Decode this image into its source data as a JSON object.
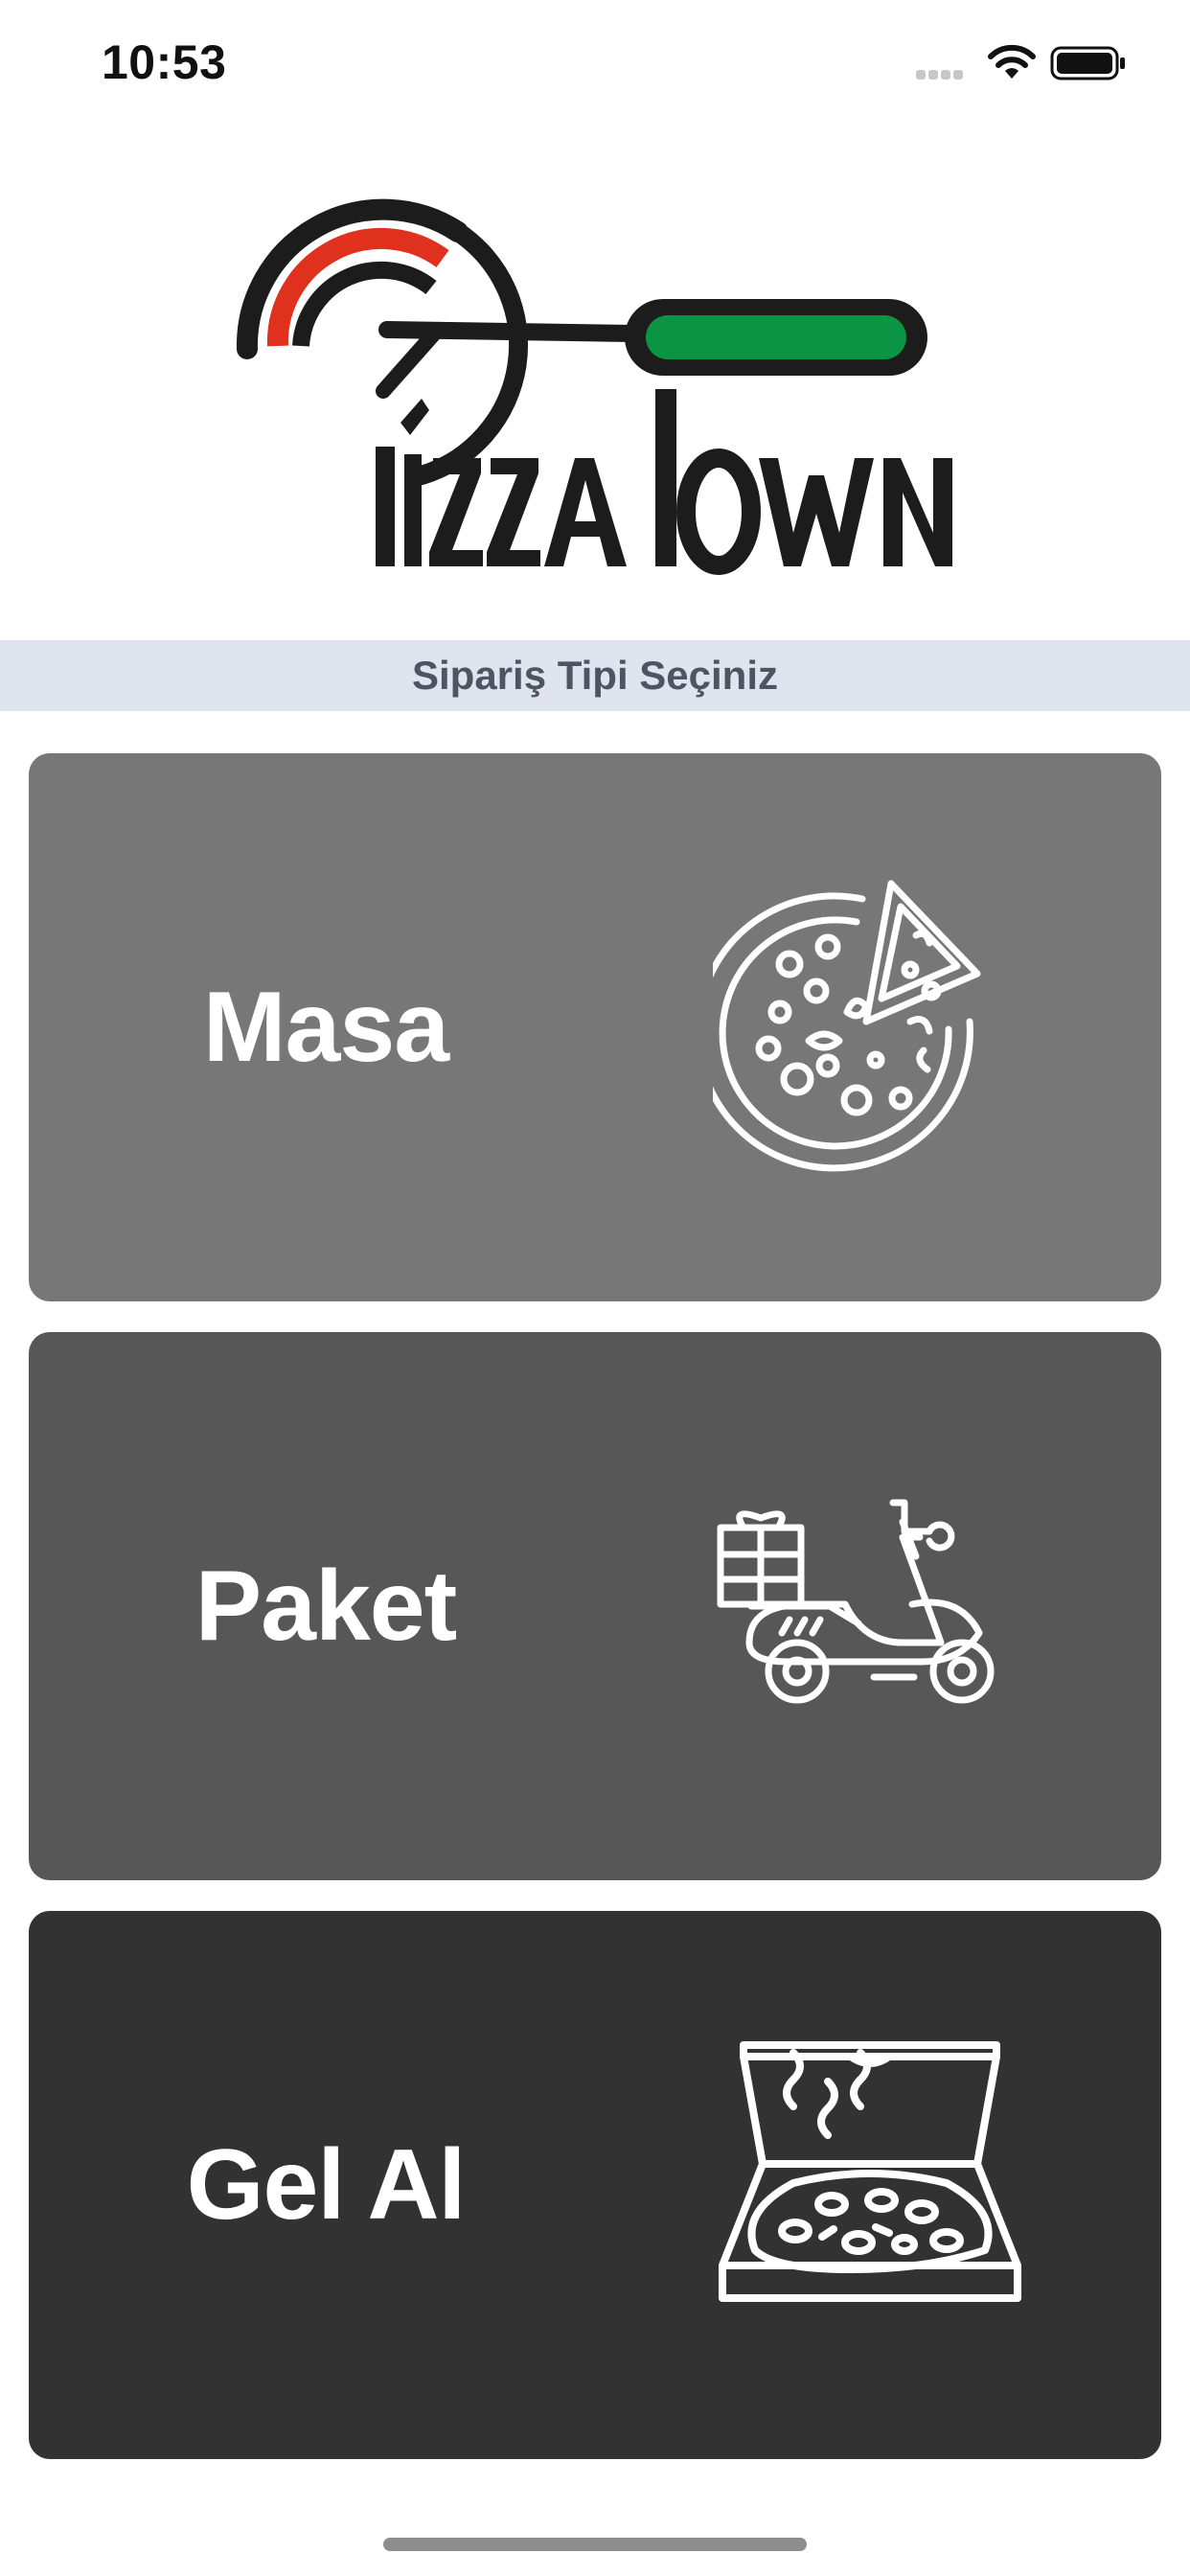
{
  "status_bar": {
    "time": "10:53",
    "wifi_icon": "wifi-icon",
    "battery_icon": "battery-icon"
  },
  "logo": {
    "text": "PizzaTown",
    "accent_red": "#e0301e",
    "accent_green": "#0a9444",
    "ink": "#1c1c1c"
  },
  "header": {
    "subtitle": "Sipariş Tipi Seçiniz"
  },
  "order_types": [
    {
      "label": "Masa",
      "icon": "pizza-icon",
      "color": "#777777"
    },
    {
      "label": "Paket",
      "icon": "scooter-delivery-icon",
      "color": "#575757"
    },
    {
      "label": "Gel Al",
      "icon": "pizza-box-icon",
      "color": "#323232"
    }
  ]
}
